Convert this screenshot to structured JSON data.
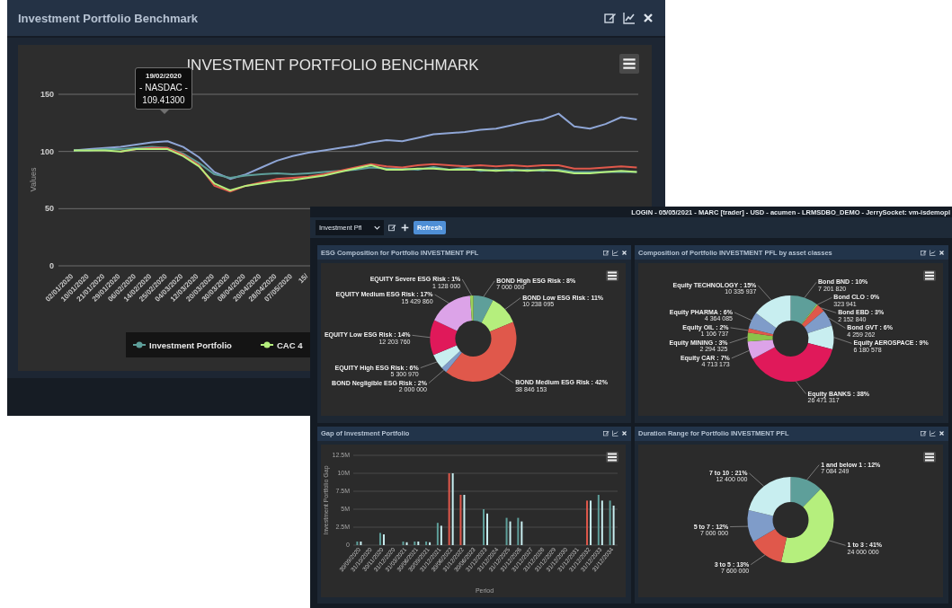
{
  "benchmark_window": {
    "title": "Investment Portfolio Benchmark",
    "chart_data": {
      "type": "line",
      "title": "INVESTMENT PORTFOLIO BENCHMARK",
      "ylabel": "Values",
      "grid": true,
      "categories": [
        "02/01/2020",
        "10/01/2020",
        "21/01/2020",
        "29/01/2020",
        "06/02/2020",
        "14/02/2020",
        "25/02/2020",
        "04/03/2020",
        "12/03/2020",
        "20/03/2020",
        "30/03/2020",
        "08/04/2020",
        "20/04/2020",
        "28/04/2020",
        "07/05/2020",
        "15/",
        null,
        null,
        null,
        null,
        null,
        null,
        null,
        null,
        null,
        null,
        null,
        null,
        null,
        null,
        null,
        null,
        null,
        null,
        null,
        null,
        null
      ],
      "ylim": [
        0,
        150
      ],
      "yticks": [
        0,
        50,
        100,
        150
      ],
      "series": [
        {
          "color": "#8fa6d6",
          "values": [
            101,
            102,
            103,
            104,
            106,
            108,
            109,
            104,
            95,
            82,
            76,
            80,
            86,
            92,
            96,
            99,
            101,
            103,
            105,
            108,
            110,
            109,
            112,
            115,
            116,
            117,
            119,
            120,
            123,
            126,
            128,
            133,
            122,
            120,
            124,
            130,
            128
          ]
        },
        {
          "name": "Investment Portfolio",
          "color": "#5e9f9a",
          "values": [
            101,
            101,
            102,
            102,
            103,
            104,
            103,
            98,
            90,
            80,
            77,
            79,
            80,
            81,
            80,
            81,
            82,
            83,
            84,
            86,
            85,
            85,
            84,
            86.5,
            84,
            85.5,
            83,
            84,
            83,
            84,
            83,
            84,
            82,
            82,
            82,
            82,
            82
          ]
        },
        {
          "color": "#e0584b",
          "values": [
            null,
            null,
            null,
            100,
            102,
            103,
            103,
            97,
            88,
            70,
            65,
            70,
            73,
            76,
            77,
            78,
            80,
            83,
            86,
            89,
            87,
            86,
            88,
            89,
            88,
            87,
            88,
            87,
            88,
            87,
            88,
            88,
            85,
            85,
            86,
            87,
            86
          ]
        },
        {
          "name": "CAC 4",
          "color": "#b5ef7d",
          "values": [
            101,
            101,
            101,
            100,
            102,
            102,
            102,
            96,
            87,
            72,
            66,
            70,
            72,
            74,
            75,
            77,
            79,
            82,
            85,
            88,
            84,
            84,
            85,
            85,
            84,
            84,
            84,
            83,
            84,
            83,
            84,
            83,
            81,
            81,
            82,
            83,
            82
          ]
        }
      ],
      "legend": true
    },
    "tooltip": {
      "date": "19/02/2020",
      "series": "- NASDAC -",
      "value": "109.41300"
    }
  },
  "dashboard_window": {
    "status_text": "LOGIN - 05/05/2021 - MARC [trader] - USD - acumen - LRMSDBO_DEMO - JerrySocket: vm-isdemopl",
    "portfolio_select": {
      "value": "Investment Pfl"
    },
    "refresh_button": "Refresh",
    "panels": [
      {
        "title": "ESG Composition for Portfolio INVESTMENT PFL",
        "chart_data": {
          "type": "donut",
          "categories": [
            "BOND High ESG Risk : 8%",
            "BOND Low ESG Risk : 11%",
            "BOND Medium ESG Risk : 42%",
            "BOND Negligible ESG Risk : 2%",
            "EQUITY High ESG Risk : 6%",
            "EQUITY Low ESG Risk : 14%",
            "EQUITY Medium ESG Risk : 17%",
            "EQUITY Severe ESG Risk : 1%"
          ],
          "values": [
            7000000,
            10238095,
            38846153,
            2000000,
            5300970,
            12203760,
            15429860,
            1128000
          ],
          "colors": [
            "#5e9f9a",
            "#b5ef7d",
            "#e0584b",
            "#7f9cc9",
            "#c8eef0",
            "#e0195a",
            "#dca3e8",
            "#9bd158"
          ],
          "value_labels": [
            "7 000 000",
            "10 238 095",
            "38 846 153",
            "2 000 000",
            "5 300 970",
            "12 203 760",
            "15 429 860",
            "1 128 000"
          ]
        }
      },
      {
        "title": "Composition of Portfolio INVESTMENT PFL by asset classes",
        "chart_data": {
          "type": "donut",
          "categories": [
            "Bond BND : 10%",
            "Bond CLO : 0%",
            "Bond EBD : 3%",
            "Bond GVT : 6%",
            "Equity AEROSPACE : 9%",
            "Equity BANKS : 38%",
            "Equity CAR : 7%",
            "Equity MINING : 3%",
            "Equity OIL : 2%",
            "Equity PHARMA : 6%",
            "Equity TECHNOLOGY : 15%"
          ],
          "values": [
            7201820,
            323941,
            2152840,
            4259262,
            6180578,
            26471317,
            4713173,
            2294325,
            1106737,
            4364085,
            10335937
          ],
          "colors": [
            "#5e9f9a",
            "#9bd158",
            "#e0584b",
            "#7f9cc9",
            "#c8eef0",
            "#e0195a",
            "#dca3e8",
            "#8bc34a",
            "#e0584b",
            "#7f9cc9",
            "#c8eef0"
          ],
          "value_labels": [
            "7 201 820",
            "323 941",
            "2 152 840",
            "4 259 262",
            "6 180 578",
            "26 471 317",
            "4 713 173",
            "2 294 325",
            "1 106 737",
            "4 364 085",
            "10 335 937"
          ]
        }
      },
      {
        "title": "Gap of Investment Portfolio",
        "chart_data": {
          "type": "bar",
          "xlabel": "Period",
          "ylabel": "Investment Portfolio Gap",
          "grid": true,
          "categories": [
            "30/09/2020",
            "31/10/2020",
            "30/11/2020",
            "31/12/2020",
            "31/03/2021",
            "30/06/2021",
            "30/09/2021",
            "31/12/2021",
            "30/06/2022",
            "31/12/2022",
            "30/06/2023",
            "31/12/2023",
            "31/12/2024",
            "31/12/2025",
            "31/12/2026",
            "31/12/2027",
            "31/12/2028",
            "31/12/2029",
            "31/12/2030",
            "31/12/2031",
            "31/12/2032",
            "31/12/2033",
            "31/12/2034"
          ],
          "ylim": [
            0,
            12.5
          ],
          "yticks": [
            {
              "value": 0,
              "label": "0"
            },
            {
              "value": 2.5,
              "label": "2.5M"
            },
            {
              "value": 5,
              "label": "5M"
            },
            {
              "value": 7.5,
              "label": "7.5M"
            },
            {
              "value": 10,
              "label": "10M"
            },
            {
              "value": 12.5,
              "label": "12.5M"
            }
          ],
          "series": [
            {
              "color": "#5e9f9a",
              "values": [
                0.5,
                null,
                1.7,
                null,
                0.5,
                0.5,
                0.5,
                3.1,
                null,
                null,
                null,
                5,
                null,
                3.8,
                3.8,
                null,
                null,
                null,
                null,
                null,
                null,
                7,
                6.2
              ]
            },
            {
              "color": "#e0584b",
              "values": [
                null,
                null,
                null,
                null,
                null,
                null,
                null,
                null,
                10,
                7,
                null,
                null,
                null,
                null,
                null,
                null,
                null,
                null,
                null,
                null,
                6.2,
                null,
                null
              ]
            },
            {
              "color": "#c8eef0",
              "values": [
                0.5,
                null,
                1.5,
                null,
                0.4,
                0.5,
                0.4,
                2.7,
                10,
                7,
                null,
                4.4,
                null,
                3.3,
                3.3,
                null,
                null,
                null,
                null,
                null,
                6.2,
                6.2,
                5.5
              ]
            }
          ]
        }
      },
      {
        "title": "Duration Range for Portfolio INVESTMENT PFL",
        "chart_data": {
          "type": "donut",
          "categories": [
            "1 and below 1 : 12%",
            "1 to 3 : 41%",
            "3 to 5 : 13%",
            "5 to 7 : 12%",
            "7 to 10 : 21%"
          ],
          "values": [
            7084249,
            24000000,
            7600000,
            7000000,
            12400000
          ],
          "colors": [
            "#5e9f9a",
            "#b5ef7d",
            "#e0584b",
            "#7f9cc9",
            "#c8eef0"
          ],
          "value_labels": [
            "7 084 249",
            "24 000 000",
            "7 600 000",
            "7 000 000",
            "12 400 000"
          ]
        }
      }
    ]
  }
}
